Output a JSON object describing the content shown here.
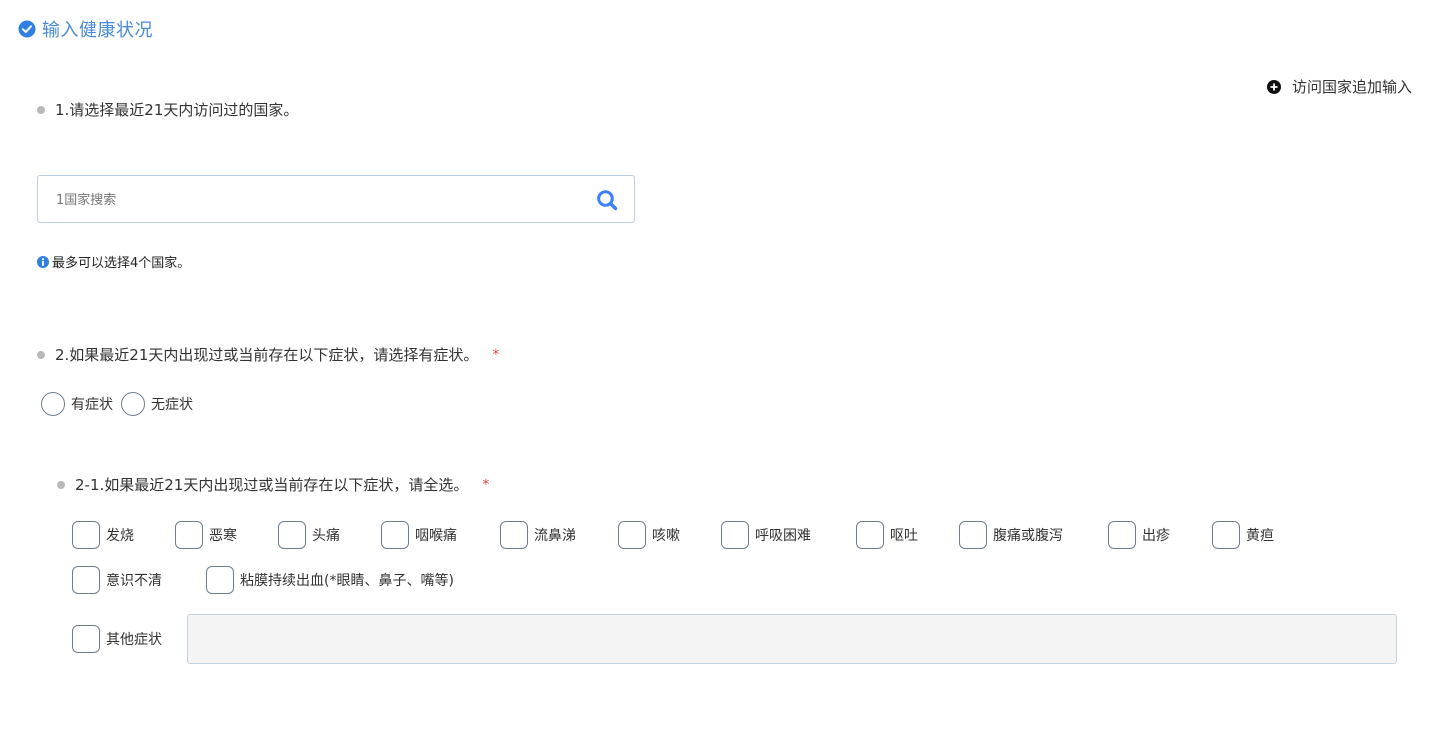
{
  "section": {
    "title": "输入健康状况"
  },
  "add_country": {
    "label": "访问国家追加输入"
  },
  "q1": {
    "text": "1.请选择最近21天内访问过的国家。",
    "search_placeholder": "1国家搜索",
    "hint": "最多可以选择4个国家。"
  },
  "q2": {
    "text": "2.如果最近21天内出现过或当前存在以下症状，请选择有症状。",
    "required_mark": "*",
    "options": [
      "有症状",
      "无症状"
    ]
  },
  "q2_1": {
    "text": "2-1.如果最近21天内出现过或当前存在以下症状，请全选。",
    "required_mark": "*",
    "symptoms_row1": [
      "发烧",
      "恶寒",
      "头痛",
      "咽喉痛",
      "流鼻涕",
      "咳嗽",
      "呼吸困难",
      "呕吐",
      "腹痛或腹泻",
      "出疹",
      "黄疸"
    ],
    "symptoms_row2": [
      "意识不清",
      "粘膜持续出血(*眼睛、鼻子、嘴等)"
    ],
    "other_label": "其他症状",
    "other_value": ""
  },
  "colors": {
    "accent": "#4a8bd6",
    "required": "#e04b4b",
    "search_icon": "#3b82f6"
  }
}
